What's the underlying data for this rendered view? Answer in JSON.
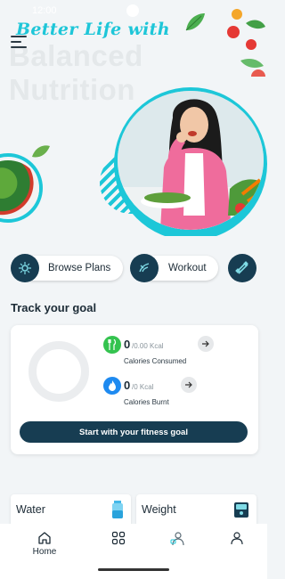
{
  "status_bar": {
    "time": "12:00"
  },
  "hero": {
    "script_title": "Better Life with",
    "bg_title_line1": "Balanced",
    "bg_title_line2": "Nutrition"
  },
  "quick_nav": [
    {
      "label": "Browse Plans",
      "icon": "sparkle-gear-icon"
    },
    {
      "label": "Workout",
      "icon": "workout-icon"
    },
    {
      "label": "",
      "icon": "dumbbell-icon"
    }
  ],
  "track_goal": {
    "title": "Track your goal",
    "consumed": {
      "value": "0",
      "unit": "/0.00 Kcal",
      "label": "Calories Consumed",
      "icon": "fork-knife-icon",
      "color": "#34c34f"
    },
    "burnt": {
      "value": "0",
      "unit": "/0 Kcal",
      "label": "Calories Burnt",
      "icon": "flame-icon",
      "color": "#1e8af0"
    },
    "cta_label": "Start with your fitness goal"
  },
  "trackers": {
    "water": {
      "label": "Water",
      "icon": "water-bottle-icon"
    },
    "weight": {
      "label": "Weight",
      "icon": "scale-icon"
    }
  },
  "bottom_nav": {
    "home": "Home"
  },
  "colors": {
    "accent": "#1dc7d8",
    "dark": "#173d52"
  }
}
